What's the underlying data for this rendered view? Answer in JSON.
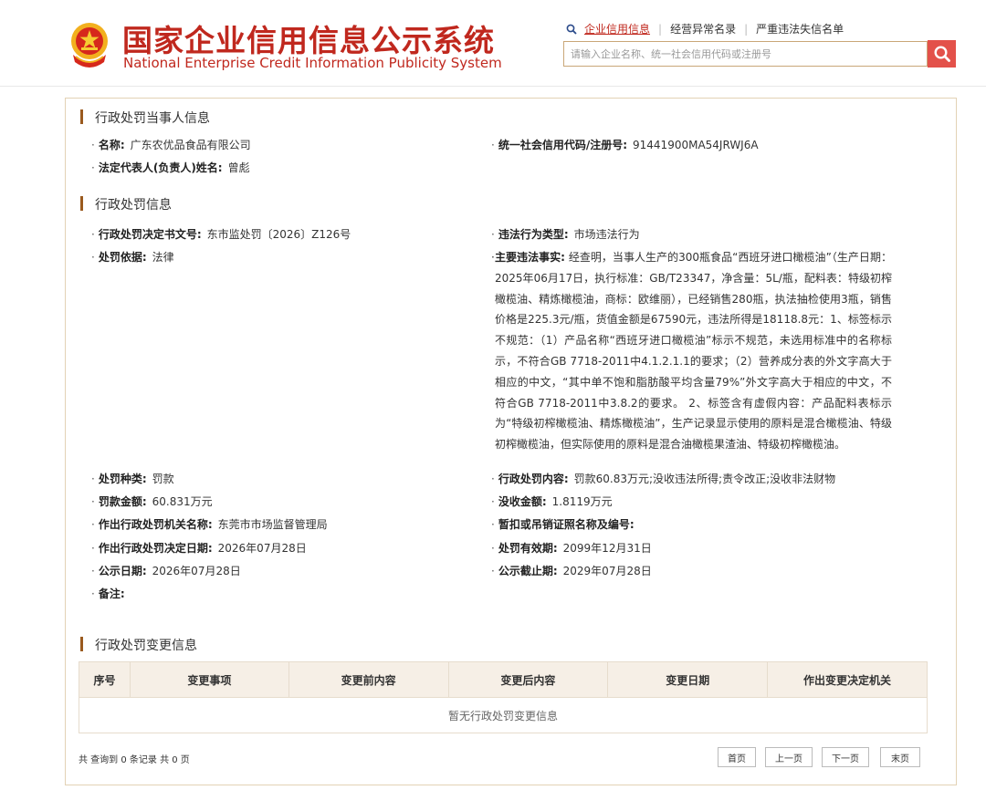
{
  "header": {
    "title_cn": "国家企业信用信息公示系统",
    "title_en": "National Enterprise Credit Information Publicity System",
    "links": [
      "企业信用信息",
      "经营异常名录",
      "严重违法失信名单"
    ],
    "search_placeholder": "请输入企业名称、统一社会信用代码或注册号",
    "search_icon": "search-icon",
    "brand_color": "#c0281e"
  },
  "party": {
    "title": "行政处罚当事人信息",
    "name_label": "名称:",
    "name_value": "广东农优品食品有限公司",
    "credit_code_label": "统一社会信用代码/注册号:",
    "credit_code_value": "91441900MA54JRWJ6A",
    "legal_rep_label": "法定代表人(负责人)姓名:",
    "legal_rep_value": "曾彪"
  },
  "penalty": {
    "title": "行政处罚信息",
    "doc_no_label": "行政处罚决定书文号:",
    "doc_no_value": "东市监处罚〔2026〕Z126号",
    "violation_type_label": "违法行为类型:",
    "violation_type_value": "市场违法行为",
    "basis_label": "处罚依据:",
    "basis_value": "法律",
    "main_fact_label": "主要违法事实:",
    "main_fact_value": "经查明，当事人生产的300瓶食品“西班牙进口橄榄油”（生产日期：2025年06月17日，执行标准：GB/T23347，净含量：5L/瓶，配料表：特级初榨橄榄油、精炼橄榄油，商标：欧维丽），已经销售280瓶，执法抽检使用3瓶，销售价格是225.3元/瓶，货值金额是67590元，违法所得是18118.8元：1、标签标示不规范：（1）产品名称“西班牙进口橄榄油”标示不规范，未选用标准中的名称标示，不符合GB 7718-2011中4.1.2.1.1的要求；（2）营养成分表的外文字高大于相应的中文，“其中单不饱和脂肪酸平均含量79%”外文字高大于相应的中文，不符合GB 7718-2011中3.8.2的要求。 2、标签含有虚假内容：产品配料表标示为“特级初榨橄榄油、精炼橄榄油”，生产记录显示使用的原料是混合橄榄油、特级初榨橄榄油，但实际使用的原料是混合油橄榄果渣油、特级初榨橄榄油。",
    "kind_label": "处罚种类:",
    "kind_value": "罚款",
    "content_label": "行政处罚内容:",
    "content_value": "罚款60.83万元;没收违法所得;责令改正;没收非法财物",
    "fine_label": "罚款金额:",
    "fine_value": "60.831万元",
    "confiscation_label": "没收金额:",
    "confiscation_value": "1.8119万元",
    "authority_label": "作出行政处罚机关名称:",
    "authority_value": "东莞市市场监督管理局",
    "license_label": "暂扣或吊销证照名称及编号:",
    "license_value": "",
    "decision_date_label": "作出行政处罚决定日期:",
    "decision_date_value": "2026年07月28日",
    "valid_until_label": "处罚有效期:",
    "valid_until_value": "2099年12月31日",
    "publish_date_label": "公示日期:",
    "publish_date_value": "2026年07月28日",
    "publish_end_label": "公示截止期:",
    "publish_end_value": "2029年07月28日",
    "remark_label": "备注:",
    "remark_value": ""
  },
  "changes": {
    "title": "行政处罚变更信息",
    "columns": [
      "序号",
      "变更事项",
      "变更前内容",
      "变更后内容",
      "变更日期",
      "作出变更决定机关"
    ],
    "empty_text": "暂无行政处罚变更信息"
  },
  "pager": {
    "info": "共 查询到 0 条记录 共 0 页",
    "first": "首页",
    "prev": "上一页",
    "next": "下一页",
    "last": "末页"
  }
}
